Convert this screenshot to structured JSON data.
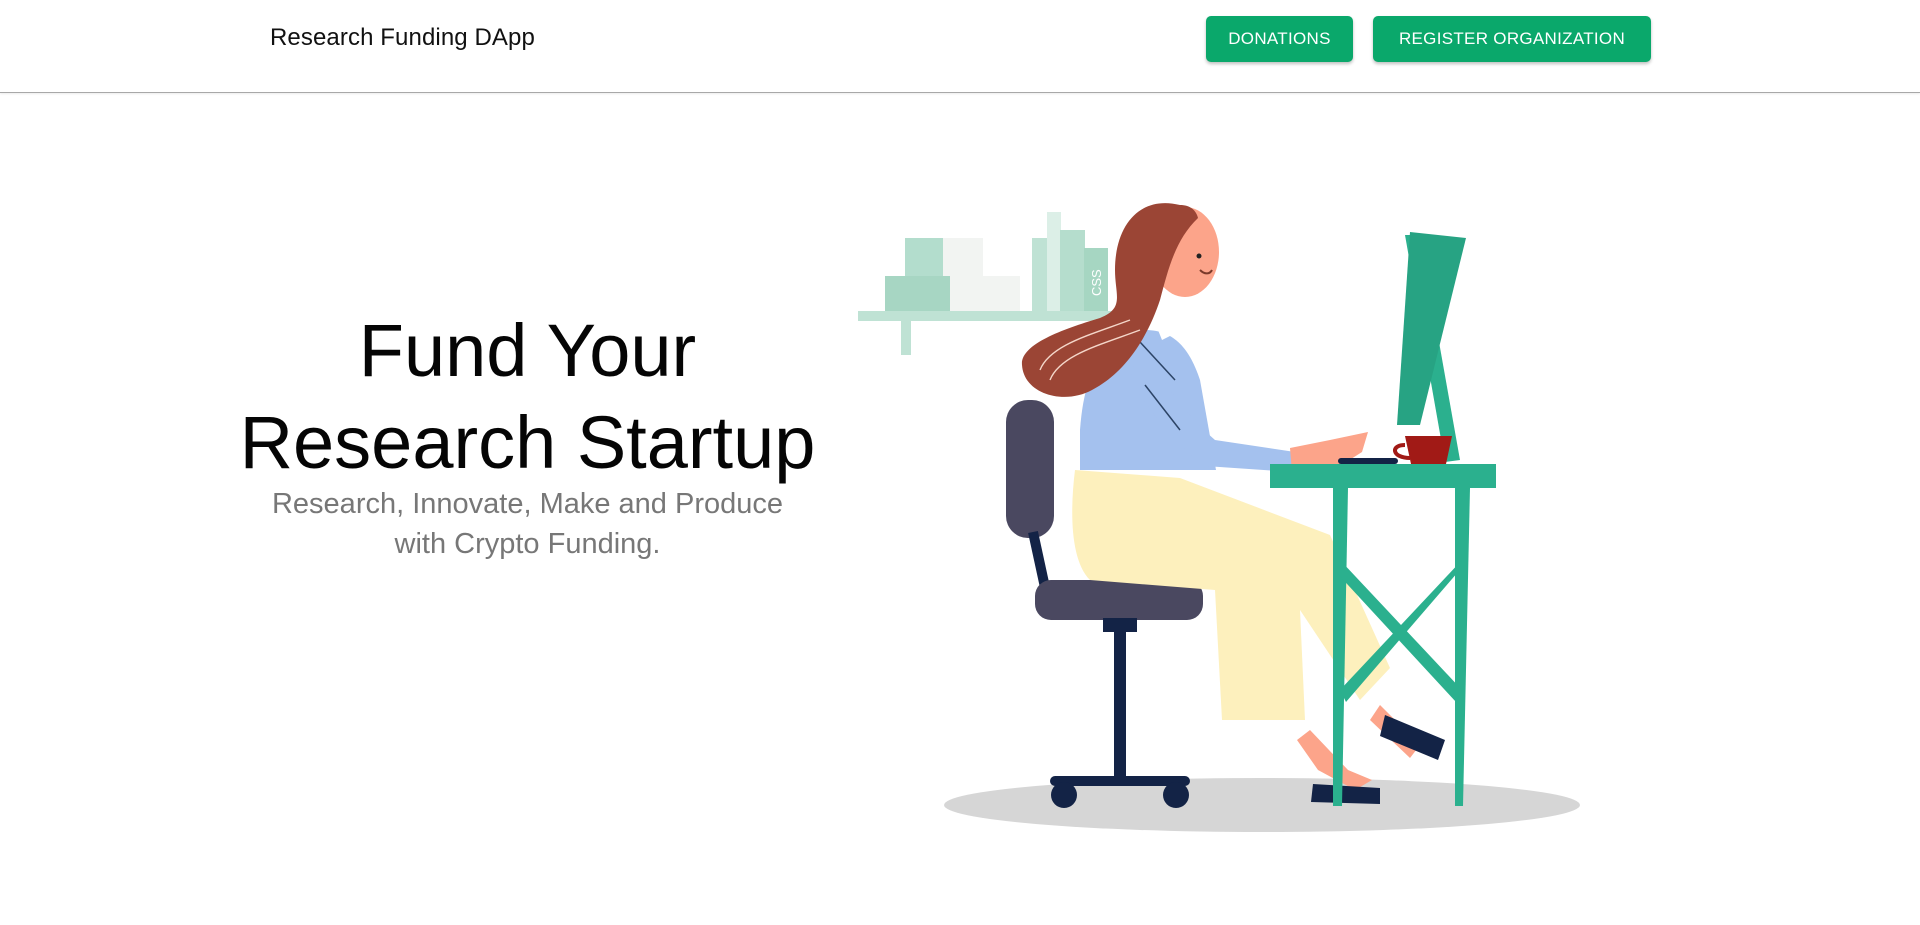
{
  "navbar": {
    "brand": "Research Funding DApp",
    "donations_label": "DONATIONS",
    "register_label": "REGISTER ORGANIZATION"
  },
  "hero": {
    "title_line1": "Fund Your",
    "title_line2": "Research Startup",
    "subtitle_line1": "Research, Innovate, Make and Produce",
    "subtitle_line2": "with Crypto Funding.",
    "book_label": "CSS"
  },
  "colors": {
    "accent": "#0aa86b",
    "desk": "#2bb08e",
    "chair": "#4a4860",
    "shirt": "#a4c1ee",
    "pants": "#fdf0bd",
    "hair": "#9b4535",
    "skin": "#fca48a",
    "cup": "#a11a16"
  }
}
